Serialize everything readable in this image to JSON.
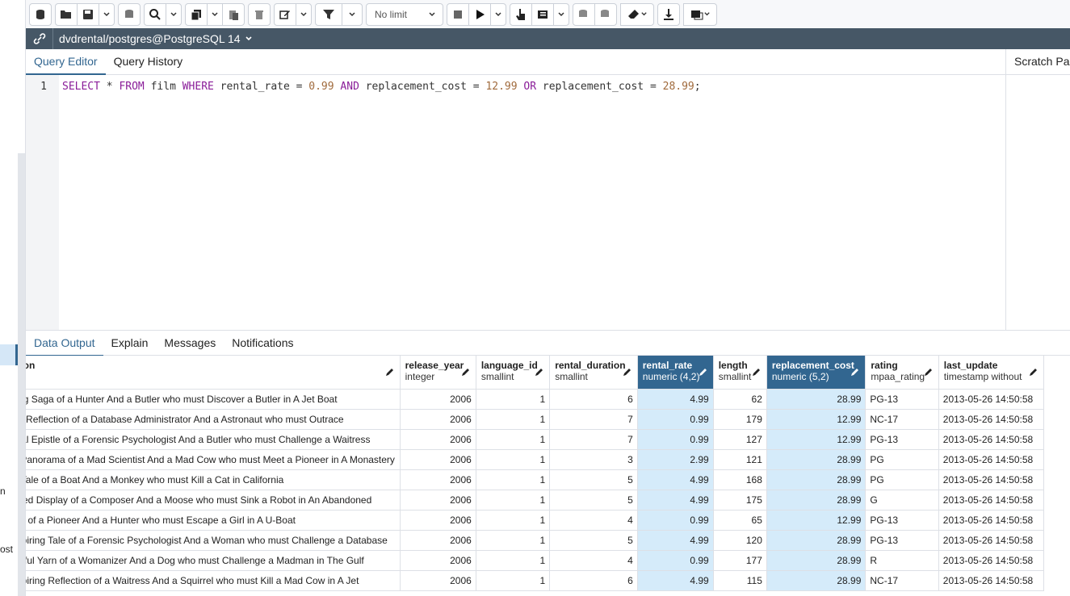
{
  "left_sidebar": {
    "fragment_1": "n",
    "fragment_2": "ost"
  },
  "toolbar": {
    "limit_label": "No limit"
  },
  "connection": {
    "label": "dvdrental/postgres@PostgreSQL 14"
  },
  "editor_tabs": {
    "query_editor": "Query Editor",
    "query_history": "Query History",
    "scratch_pad": "Scratch Pad"
  },
  "editor": {
    "line_number": "1",
    "tokens": {
      "t1": "SELECT",
      "t2": " * ",
      "t3": "FROM",
      "t4": " film ",
      "t5": "WHERE",
      "t6": " rental_rate = ",
      "t7": "0.99",
      "t8": " ",
      "t9": "AND",
      "t10": " replacement_cost = ",
      "t11": "12.99",
      "t12": " ",
      "t13": "OR",
      "t14": " replacement_cost = ",
      "t15": "28.99",
      "t16": ";"
    }
  },
  "output_tabs": {
    "data_output": "Data Output",
    "explain": "Explain",
    "messages": "Messages",
    "notifications": "Notifications"
  },
  "columns": [
    {
      "name": "ription",
      "type": ""
    },
    {
      "name": "release_year",
      "type": "integer"
    },
    {
      "name": "language_id",
      "type": "smallint"
    },
    {
      "name": "rental_duration",
      "type": "smallint"
    },
    {
      "name": "rental_rate",
      "type": "numeric (4,2)"
    },
    {
      "name": "length",
      "type": "smallint"
    },
    {
      "name": "replacement_cost",
      "type": "numeric (5,2)"
    },
    {
      "name": "rating",
      "type": "mpaa_rating"
    },
    {
      "name": "last_update",
      "type": "timestamp without"
    }
  ],
  "rows": [
    [
      "uching Saga of a Hunter And a Butler who must Discover a Butler in A Jet Boat",
      "2006",
      "1",
      "6",
      "4.99",
      "62",
      "28.99",
      "PG-13",
      "2013-05-26 14:50:58"
    ],
    [
      "azing Reflection of a Database Administrator And a Astronaut who must Outrace",
      "2006",
      "1",
      "7",
      "0.99",
      "179",
      "12.99",
      "NC-17",
      "2013-05-26 14:50:58"
    ],
    [
      "otional Epistle of a Forensic Psychologist And a Butler who must Challenge a Waitress",
      "2006",
      "1",
      "7",
      "0.99",
      "127",
      "12.99",
      "PG-13",
      "2013-05-26 14:50:58"
    ],
    [
      "liant Panorama of a Mad Scientist And a Mad Cow who must Meet a Pioneer in A Monastery",
      "2006",
      "1",
      "3",
      "2.99",
      "121",
      "28.99",
      "PG",
      "2013-05-26 14:50:58"
    ],
    [
      "epid Tale of a Boat And a Monkey who must Kill a Cat in California",
      "2006",
      "1",
      "5",
      "4.99",
      "168",
      "28.99",
      "PG",
      "2013-05-26 14:50:58"
    ],
    [
      "t-Paced Display of a Composer And a Moose who must Sink a Robot in An Abandoned",
      "2006",
      "1",
      "5",
      "4.99",
      "175",
      "28.99",
      "G",
      "2013-05-26 14:50:58"
    ],
    [
      "c Tale of a Pioneer And a Hunter who must Escape a Girl in A U-Boat",
      "2006",
      "1",
      "4",
      "0.99",
      "65",
      "12.99",
      "PG-13",
      "2013-05-26 14:50:58"
    ],
    [
      "e-Inspiring Tale of a Forensic Psychologist And a Woman who must Challenge a Database",
      "2006",
      "1",
      "5",
      "4.99",
      "120",
      "28.99",
      "PG-13",
      "2013-05-26 14:50:58"
    ],
    [
      "oughtful Yarn of a Womanizer And a Dog who must Challenge a Madman in The Gulf",
      "2006",
      "1",
      "4",
      "0.99",
      "177",
      "28.99",
      "R",
      "2013-05-26 14:50:58"
    ],
    [
      "e-Inspiring Reflection of a Waitress And a Squirrel who must Kill a Mad Cow in A Jet",
      "2006",
      "1",
      "6",
      "4.99",
      "115",
      "28.99",
      "NC-17",
      "2013-05-26 14:50:58"
    ]
  ],
  "colors": {
    "accent": "#326690",
    "connection_bar": "#465766",
    "selected_cell": "#d5ebfa",
    "keyword": "#8a1d99",
    "number": "#a06a3c"
  }
}
